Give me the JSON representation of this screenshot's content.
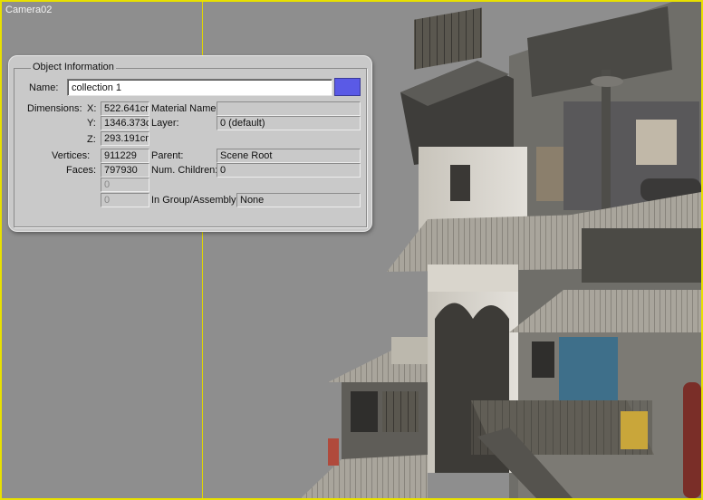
{
  "viewport": {
    "label": "Camera02"
  },
  "panel": {
    "title": "Object Information",
    "name_label": "Name:",
    "name_value": "collection 1",
    "swatch_color": "#5a5ae6",
    "dimensions_label": "Dimensions:",
    "x_label": "X:",
    "x_value": "522.641cm",
    "y_label": "Y:",
    "y_value": "1346.373c",
    "z_label": "Z:",
    "z_value": "293.191cm",
    "vertices_label": "Vertices:",
    "vertices_value": "911229",
    "faces_label": "Faces:",
    "faces_value": "797930",
    "extra1_value": "0",
    "extra2_value": "0",
    "material_label": "Material Name:",
    "material_value": "",
    "layer_label": "Layer:",
    "layer_value": "0 (default)",
    "parent_label": "Parent:",
    "parent_value": "Scene Root",
    "children_label": "Num. Children:",
    "children_value": "0",
    "group_label": "In Group/Assembly:",
    "group_value": "None"
  }
}
